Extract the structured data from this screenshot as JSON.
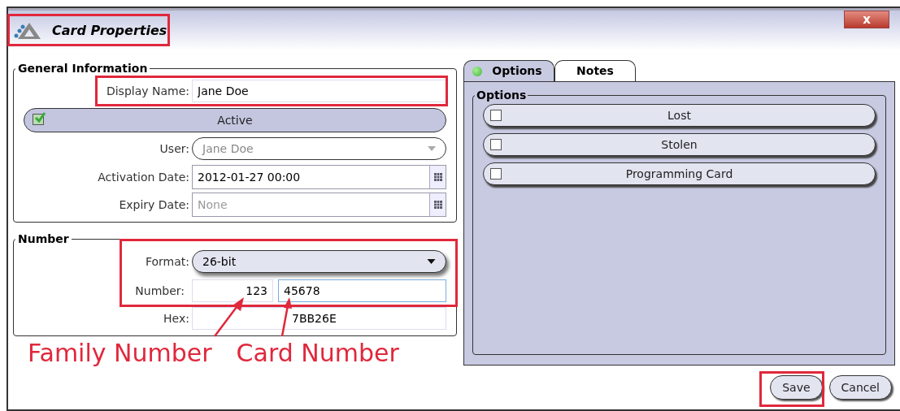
{
  "window": {
    "title": "Card Properties",
    "close_label": "x"
  },
  "general_information": {
    "legend": "General Information",
    "display_name": {
      "label": "Display Name:",
      "value": "Jane Doe"
    },
    "active": {
      "label": "Active",
      "checked": true
    },
    "user": {
      "label": "User:",
      "value": "Jane Doe"
    },
    "activation_date": {
      "label": "Activation Date:",
      "value": "2012-01-27 00:00"
    },
    "expiry_date": {
      "label": "Expiry Date:",
      "placeholder": "None"
    }
  },
  "number": {
    "legend": "Number",
    "format": {
      "label": "Format:",
      "value": "26-bit"
    },
    "number": {
      "label": "Number:",
      "family": "123",
      "card": "45678"
    },
    "hex": {
      "label": "Hex:",
      "value": "7BB26E"
    }
  },
  "annotations": [
    {
      "text": "Family Number"
    },
    {
      "text": "Card Number"
    }
  ],
  "tabs": [
    {
      "label": "Options",
      "selected": true
    },
    {
      "label": "Notes",
      "selected": false
    }
  ],
  "options": {
    "legend": "Options",
    "items": [
      {
        "label": "Lost",
        "checked": false
      },
      {
        "label": "Stolen",
        "checked": false
      },
      {
        "label": "Programming Card",
        "checked": false
      }
    ]
  },
  "buttons": [
    {
      "label": "Save"
    },
    {
      "label": "Cancel"
    }
  ]
}
